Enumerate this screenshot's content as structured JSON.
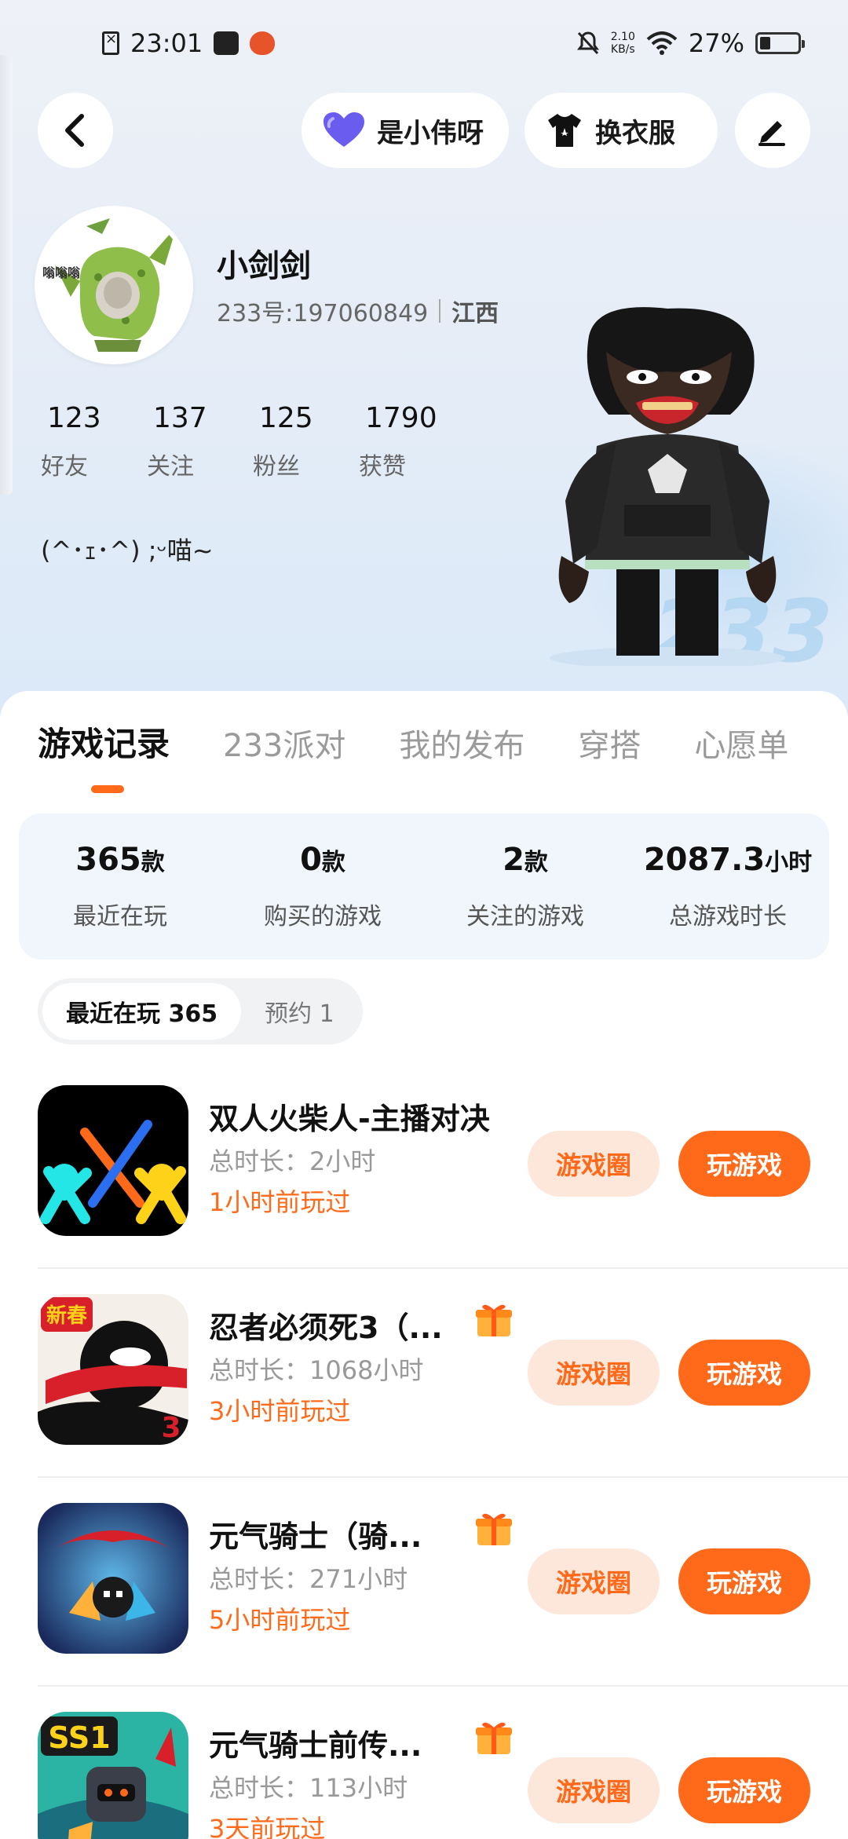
{
  "status_bar": {
    "time": "23:01",
    "net_speed_value": "2.10",
    "net_speed_unit": "KB/s",
    "battery": "27%"
  },
  "header": {
    "friend_button_label": "是小伟呀",
    "outfit_button_label": "换衣服"
  },
  "profile": {
    "nickname": "小剑剑",
    "id_label": "233号:197060849",
    "region": "江西",
    "avatar_caption": "嗡嗡嗡",
    "bio": "(^･ｪ･^) ;ᵕ喵~",
    "stats": [
      {
        "value": "123",
        "label": "好友"
      },
      {
        "value": "137",
        "label": "关注"
      },
      {
        "value": "125",
        "label": "粉丝"
      },
      {
        "value": "1790",
        "label": "获赞"
      }
    ]
  },
  "tabs": [
    {
      "label": "游戏记录",
      "active": true
    },
    {
      "label": "233派对",
      "active": false
    },
    {
      "label": "我的发布",
      "active": false
    },
    {
      "label": "穿搭",
      "active": false
    },
    {
      "label": "心愿单",
      "active": false
    }
  ],
  "summary": [
    {
      "value": "365",
      "unit": "款",
      "label": "最近在玩"
    },
    {
      "value": "0",
      "unit": "款",
      "label": "购买的游戏"
    },
    {
      "value": "2",
      "unit": "款",
      "label": "关注的游戏"
    },
    {
      "value": "2087.3",
      "unit": "小时",
      "label": "总游戏时长"
    }
  ],
  "segment": {
    "recent": "最近在玩 365",
    "reserve": "预约 1"
  },
  "games": [
    {
      "title": "双人火柴人-主播对决",
      "duration": "总时长：2小时",
      "last_played": "1小时前玩过",
      "has_gift": false,
      "circle_label": "游戏圈",
      "play_label": "玩游戏"
    },
    {
      "title": "忍者必须死3（...",
      "duration": "总时长：1068小时",
      "last_played": "3小时前玩过",
      "has_gift": true,
      "circle_label": "游戏圈",
      "play_label": "玩游戏"
    },
    {
      "title": "元气骑士（骑...",
      "duration": "总时长：271小时",
      "last_played": "5小时前玩过",
      "has_gift": true,
      "circle_label": "游戏圈",
      "play_label": "玩游戏"
    },
    {
      "title": "元气骑士前传...",
      "duration": "总时长：113小时",
      "last_played": "3天前玩过",
      "has_gift": true,
      "circle_label": "游戏圈",
      "play_label": "玩游戏"
    }
  ],
  "game_icon_badges": {
    "ninja_badge": "新春",
    "ninja_number": "3",
    "prequel_badge": "SS1"
  },
  "colors": {
    "accent": "#ff6a1a",
    "accent_light": "#fde6da",
    "summary_bg": "#f1f6fd",
    "heart": "#6b5cf0"
  }
}
